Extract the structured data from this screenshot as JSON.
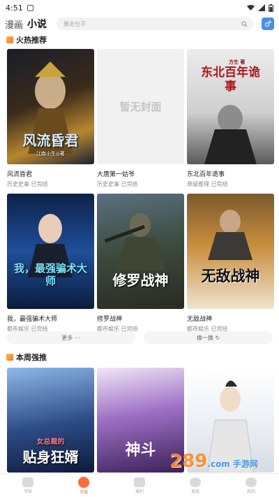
{
  "status_bar": {
    "time": "4:51"
  },
  "tabs": [
    "漫画",
    "小说"
  ],
  "search": {
    "placeholder": "暴走包子"
  },
  "hot_section": {
    "title": "火热推荐"
  },
  "hot_books": [
    {
      "cover_text": "风流昏君",
      "cover_sub": "江南小生◎著",
      "name": "风流昏君",
      "meta": "历史史事 已完结"
    },
    {
      "cover_text": "暂无封面",
      "cover_sub": "",
      "name": "大唐第一姑爷",
      "meta": "历史史事 已完结"
    },
    {
      "cover_text": "东北百年诡事",
      "cover_sub": "方生 著",
      "name": "东北百年诡事",
      "meta": "悬疑推理 已完结"
    },
    {
      "cover_text": "我，最强骗术大师",
      "cover_sub": "",
      "name": "我，最强骗术大师",
      "meta": "都市娱乐 已完结"
    },
    {
      "cover_text": "修罗战神",
      "cover_sub": "",
      "name": "修罗战神",
      "meta": "都市娱乐 已完结"
    },
    {
      "cover_text": "无敌战神",
      "cover_sub": "",
      "name": "无敌战神",
      "meta": "都市娱乐 已完结"
    }
  ],
  "actions": {
    "more": "更多 ···",
    "refresh": "换一换 ↻"
  },
  "weekly_section": {
    "title": "本周强推"
  },
  "weekly_books": [
    {
      "cover_text": "贴身狂婿",
      "cover_sub": "女总裁的"
    },
    {
      "cover_text": "神斗",
      "cover_sub": ""
    },
    {
      "cover_text": "",
      "cover_sub": ""
    }
  ],
  "bottom_nav": [
    "书架",
    "书城",
    "福利",
    "发现",
    "我的"
  ],
  "watermark": {
    "main": "289",
    "sub": ".com 手游网"
  },
  "colors": {
    "accent": "#ff6b3d",
    "gender_button": "#4a90e2"
  }
}
